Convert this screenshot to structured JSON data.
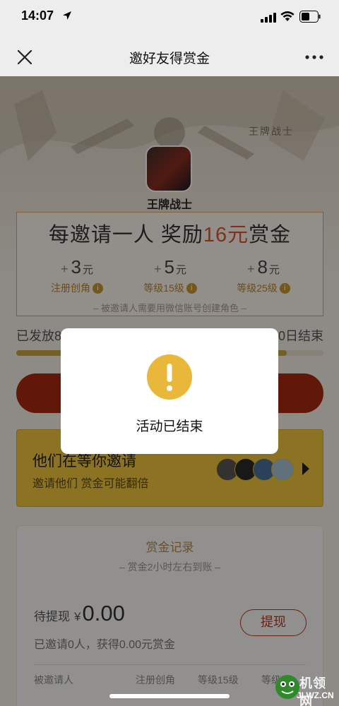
{
  "status_bar": {
    "time": "14:07",
    "icons": [
      "location-arrow-icon",
      "signal-icon",
      "wifi-icon",
      "battery-icon"
    ]
  },
  "nav": {
    "title": "邀好友得赏金",
    "close_icon": "close-icon",
    "more_icon": "more-icon"
  },
  "hero": {
    "brand_text": "王牌战士",
    "app_name": "王牌战士"
  },
  "reward": {
    "headline_pre": "每邀请一人 奖励",
    "headline_amount": "16元",
    "headline_post": "赏金",
    "tiers": [
      {
        "plus": "+",
        "amount": "3",
        "unit": "元",
        "label": "注册创角"
      },
      {
        "plus": "+",
        "amount": "5",
        "unit": "元",
        "label": "等级15级"
      },
      {
        "plus": "+",
        "amount": "8",
        "unit": "元",
        "label": "等级25级"
      }
    ],
    "info_glyph": "i",
    "note": "– 被邀请人需要用微信账号创建角色 –"
  },
  "progress": {
    "left_text": "已发放8",
    "right_text": "0日结束",
    "fill_percent": 88
  },
  "friends": {
    "title": "他们在等你邀请",
    "subtitle": "邀请他们 赏金可能翻倍",
    "avatar_colors": [
      "#5b5550",
      "#2a2a2a",
      "#4a6e9a",
      "#a7c3d6"
    ]
  },
  "records": {
    "title": "赏金记录",
    "subtitle": "– 赏金2小时左右到账 –",
    "pending_label": "待提现",
    "currency": "¥",
    "pending_amount": "0.00",
    "withdraw_label": "提现",
    "summary": "已邀请0人，获得0.00元赏金",
    "columns": [
      "被邀请人",
      "注册创角",
      "等级15级",
      "等级"
    ]
  },
  "modal": {
    "icon": "alert-icon",
    "message": "活动已结束"
  },
  "watermark": {
    "name": "机领网",
    "url": "JLWZ.CN"
  },
  "colors": {
    "accent_red": "#a92a10",
    "highlight_orange": "#e0552a",
    "gold": "#c99630",
    "alert_yellow": "#e9b83a"
  }
}
